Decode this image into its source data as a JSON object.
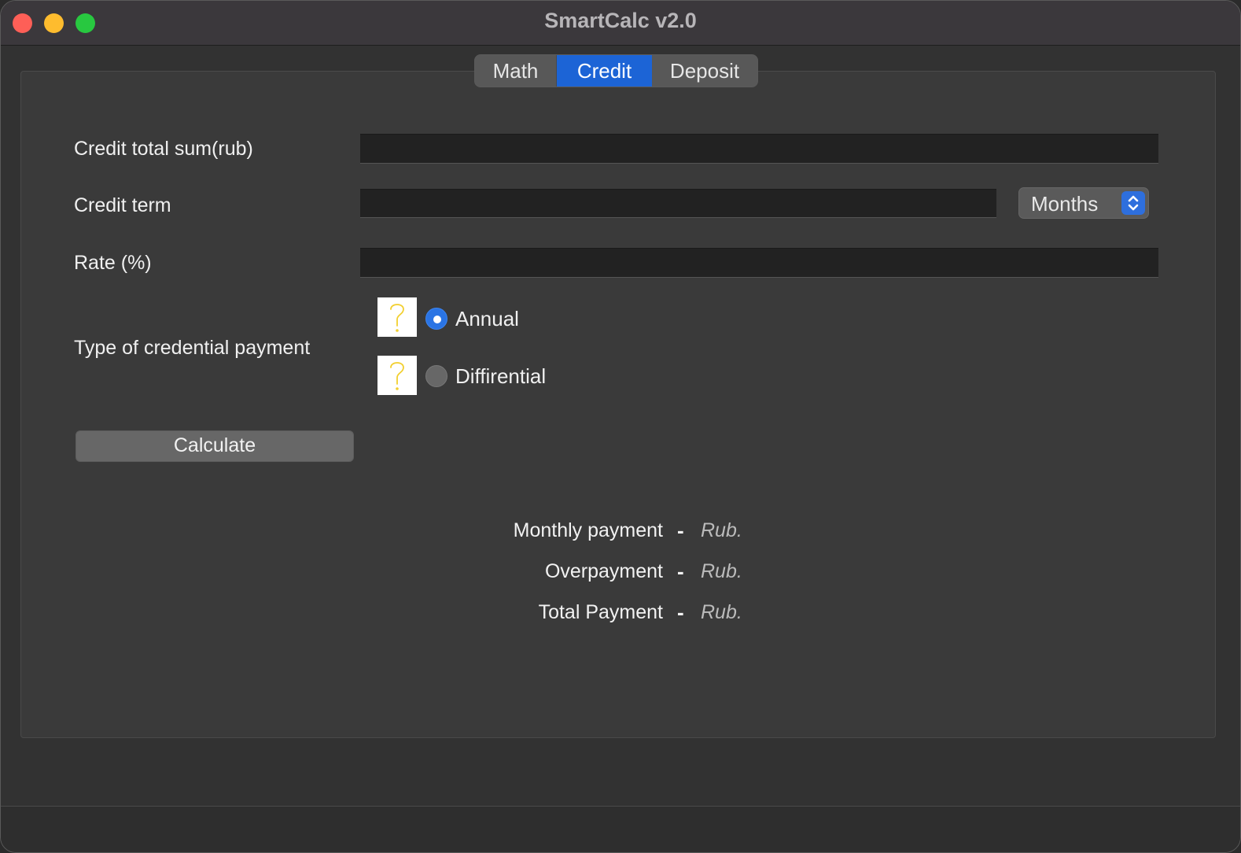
{
  "window": {
    "title": "SmartCalc v2.0"
  },
  "tabs": [
    {
      "label": "Math",
      "selected": false
    },
    {
      "label": "Credit",
      "selected": true
    },
    {
      "label": "Deposit",
      "selected": false
    }
  ],
  "form": {
    "credit_total_label": "Credit total sum(rub)",
    "credit_total_value": "",
    "credit_term_label": "Credit term",
    "credit_term_value": "",
    "term_unit": "Months",
    "rate_label": "Rate (%)",
    "rate_value": "",
    "payment_type_label": "Type of credential payment",
    "payment_types": [
      {
        "label": "Annual",
        "checked": true
      },
      {
        "label": "Diffirential",
        "checked": false
      }
    ],
    "calculate_label": "Calculate"
  },
  "results": [
    {
      "label": "Monthly payment",
      "dash": "-",
      "value": "Rub."
    },
    {
      "label": "Overpayment",
      "dash": "-",
      "value": "Rub."
    },
    {
      "label": "Total Payment",
      "dash": "-",
      "value": "Rub."
    }
  ],
  "colors": {
    "accent": "#1c64d6",
    "help_icon": "#f2cf2f"
  },
  "icons": {
    "help": "question-mark-icon",
    "select": "chevron-up-down-icon"
  }
}
